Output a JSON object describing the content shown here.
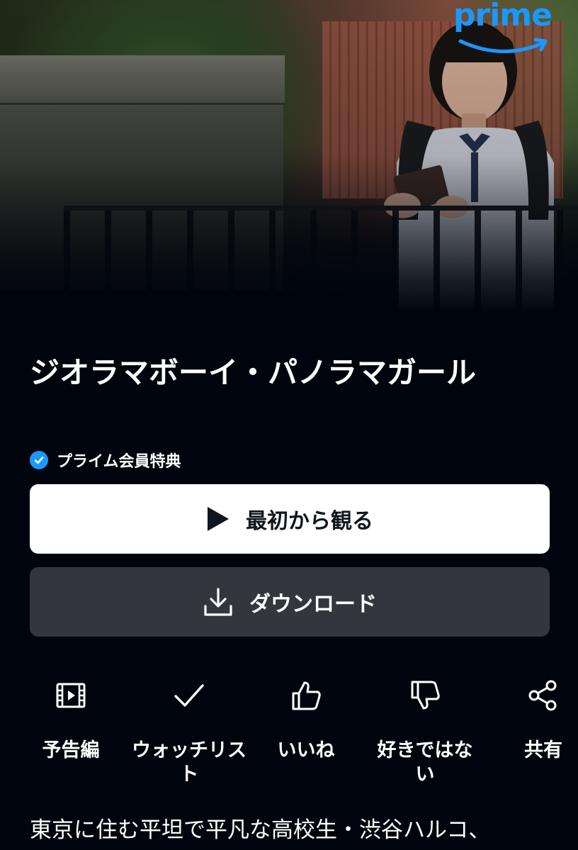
{
  "brand": {
    "logo_text": "prime",
    "accent_color": "#1a98ff"
  },
  "title": "ジオラマボーイ・パノラマガール",
  "benefit": {
    "icon": "check-circle-icon",
    "label": "プライム会員特典"
  },
  "buttons": {
    "play": {
      "icon": "play-icon",
      "label": "最初から観る"
    },
    "download": {
      "icon": "download-icon",
      "label": "ダウンロード"
    }
  },
  "actions": [
    {
      "icon": "trailer-icon",
      "label": "予告編"
    },
    {
      "icon": "checkmark-icon",
      "label": "ウォッチリスト"
    },
    {
      "icon": "thumbs-up-icon",
      "label": "いいね"
    },
    {
      "icon": "thumbs-down-icon",
      "label": "好きではない"
    },
    {
      "icon": "share-icon",
      "label": "共有"
    }
  ],
  "description": "東京に住む平坦で平凡な高校生・渋谷ハルコ、"
}
